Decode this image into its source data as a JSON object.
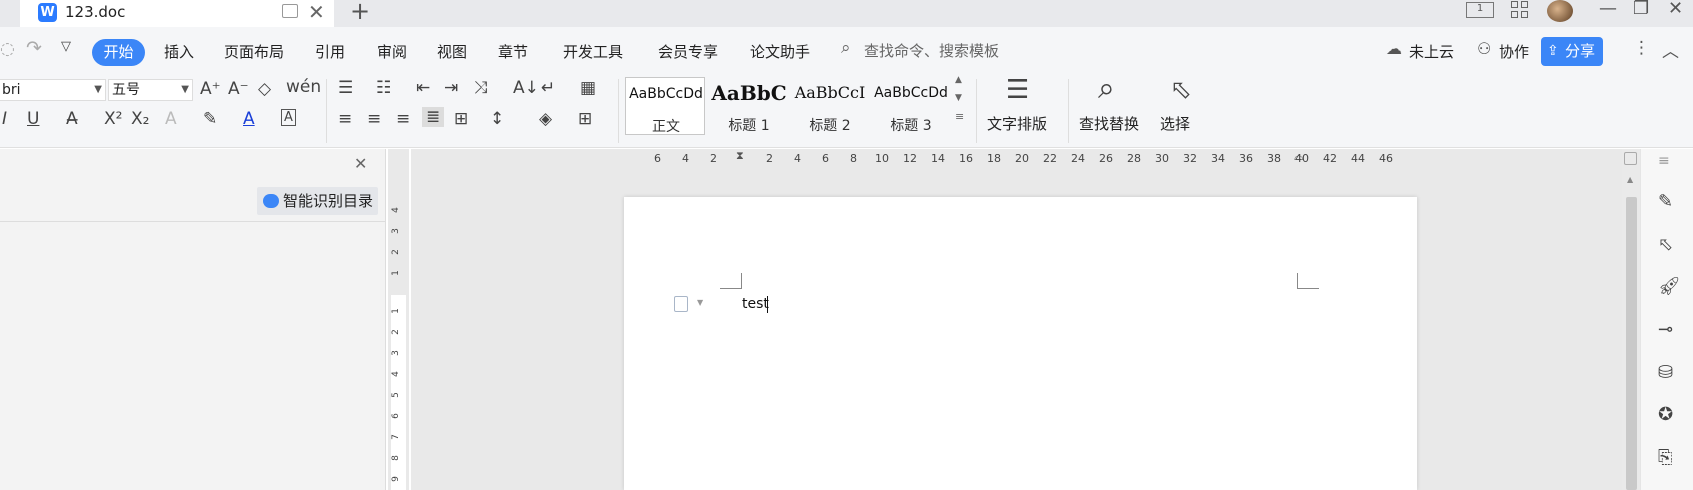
{
  "tabbar": {
    "doc_title": "123.doc",
    "logo_letter": "W",
    "new_tab_symbol": "+",
    "layout_label": "1"
  },
  "menubar": {
    "items": [
      "开始",
      "插入",
      "页面布局",
      "引用",
      "审阅",
      "视图",
      "章节",
      "开发工具",
      "会员专享",
      "论文助手"
    ],
    "search_placeholder": "查找命令、搜索模板",
    "cloud_label": "未上云",
    "collab_label": "协作",
    "share_label": "分享"
  },
  "ribbon": {
    "font_name": "bri",
    "font_size": "五号",
    "styles": [
      {
        "sample": "AaBbCcDd",
        "label": "正文"
      },
      {
        "sample": "AaBbC",
        "label": "标题 1"
      },
      {
        "sample": "AaBbCcI",
        "label": "标题 2"
      },
      {
        "sample": "AaBbCcDd",
        "label": "标题 3"
      }
    ],
    "text_layout_label": "文字排版",
    "find_replace_label": "查找替换",
    "select_label": "选择"
  },
  "leftpane": {
    "smart_toc_label": "智能识别目录"
  },
  "ruler": {
    "h_ticks": [
      "6",
      "4",
      "2",
      "2",
      "4",
      "6",
      "8",
      "10",
      "12",
      "14",
      "16",
      "18",
      "20",
      "22",
      "24",
      "26",
      "28",
      "30",
      "32",
      "34",
      "36",
      "38",
      "40",
      "42",
      "44",
      "46"
    ],
    "v_ticks_top": [
      "4",
      "3",
      "2",
      "1"
    ],
    "v_ticks_bottom": [
      "1",
      "2",
      "3",
      "4",
      "5",
      "6",
      "7",
      "8",
      "9"
    ]
  },
  "document": {
    "text": "test"
  },
  "colors": {
    "accent": "#3b86f7",
    "tabbar_bg": "#e8e9ec",
    "ribbon_bg": "#f5f6f8",
    "canvas_bg": "#e9e9e9"
  }
}
